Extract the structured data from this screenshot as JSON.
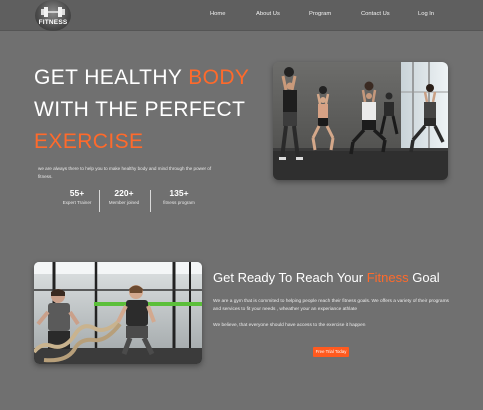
{
  "brand": {
    "logo_text": "FITNESS"
  },
  "nav": {
    "items": [
      {
        "label": "Home"
      },
      {
        "label": "About Us"
      },
      {
        "label": "Program"
      },
      {
        "label": "Contact Us"
      },
      {
        "label": "Log In"
      }
    ]
  },
  "hero": {
    "line1_prefix": "GET HEALTHY ",
    "line1_accent": "BODY",
    "line2": "WITH THE PERFECT",
    "line3_accent": "EXERCISE",
    "description": "we are always there to help you to make healthy body and mind through the power of fitness.",
    "stats": [
      {
        "value": "55+",
        "label": "Expert Trainer"
      },
      {
        "value": "220+",
        "label": "Member joined"
      },
      {
        "value": "135+",
        "label": "fitness program"
      }
    ]
  },
  "about": {
    "title_prefix": "Get Ready To Reach Your ",
    "title_accent": "Fitness",
    "title_suffix": " Goal",
    "paragraph1": "We are a gym that is commited to helping people reach their fitness goals. We offers a variety of their programs and services to fit your needs , wheather your an experiance athlate",
    "paragraph2": "We believe, that everyone should have access to the exercise it happen",
    "cta_label": "Free Trial Today"
  },
  "colors": {
    "accent": "#ff6a2b",
    "background": "#707070",
    "navbar": "#5f5f5f"
  }
}
